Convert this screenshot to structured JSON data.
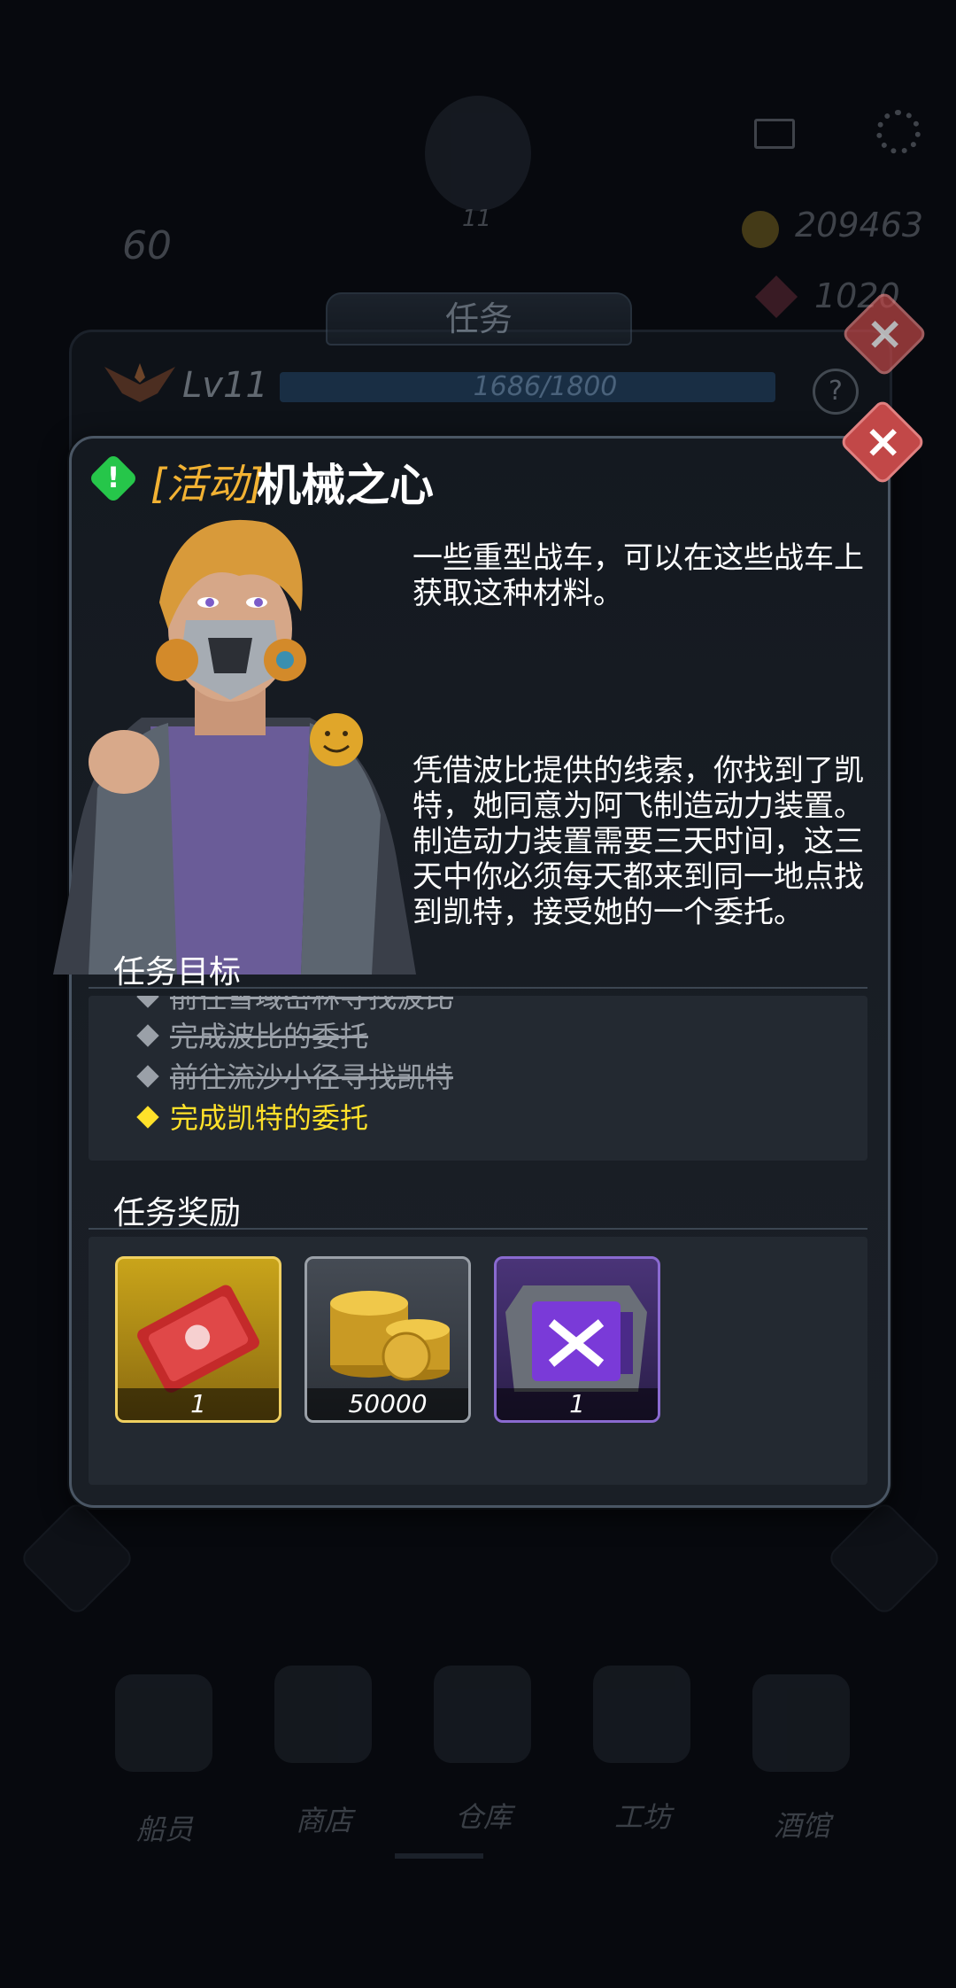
{
  "hud": {
    "level_badge_num": "11",
    "energy": "60",
    "gold": "209463",
    "gems": "1020"
  },
  "task_panel": {
    "tab_label": "任务",
    "level_label": "Lv11",
    "xp_text": "1686/1800",
    "help_label": "?"
  },
  "dialog": {
    "alert_mark": "!",
    "tag": "[活动]",
    "title": "机械之心",
    "desc_1": [
      "一些重型战车，可以在这些战车上",
      "获取这种材料。"
    ],
    "desc_2": [
      "凭借波比提供的线索，你找到了凯",
      "特，她同意为阿飞制造动力装置。",
      "制造动力装置需要三天时间，这三",
      "天中你必须每天都来到同一地点找",
      "到凯特，接受她的一个委托。"
    ],
    "objectives_title": "任务目标",
    "objectives": [
      {
        "text": "前往雪域密林寻找波比",
        "done": true
      },
      {
        "text": "完成波比的委托",
        "done": true
      },
      {
        "text": "前往流沙小径寻找凯特",
        "done": true
      },
      {
        "text": "完成凯特的委托",
        "done": false
      }
    ],
    "rewards_title": "任务奖励",
    "rewards": [
      {
        "name": "red-ticket",
        "count": "1",
        "rarity_color": "#c9a41a"
      },
      {
        "name": "gold-coins",
        "count": "50000",
        "rarity_color": "#6c737c"
      },
      {
        "name": "purple-chest",
        "count": "1",
        "rarity_color": "#6a3fb0"
      }
    ],
    "close_label": "×"
  },
  "bottom_nav": [
    {
      "label": "船员"
    },
    {
      "label": "商店"
    },
    {
      "label": "仓库"
    },
    {
      "label": "工坊"
    },
    {
      "label": "酒馆"
    }
  ],
  "colors": {
    "accent_tag": "#f2b233",
    "current_objective": "#ffe12a",
    "done_objective": "#9aa0a8",
    "close_red": "#c24848"
  }
}
